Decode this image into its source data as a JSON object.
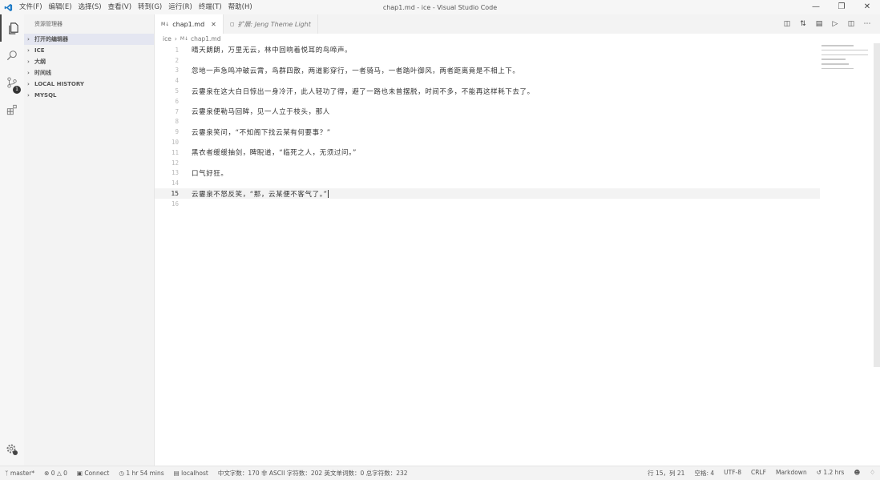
{
  "window": {
    "title": "chap1.md - ice - Visual Studio Code",
    "menu": [
      "文件(F)",
      "编辑(E)",
      "选择(S)",
      "查看(V)",
      "转到(G)",
      "运行(R)",
      "终端(T)",
      "帮助(H)"
    ]
  },
  "activity": {
    "scm_badge": "1"
  },
  "sidebar": {
    "title": "资源管理器",
    "sections": [
      "打开的编辑器",
      "ICE",
      "大纲",
      "时间线",
      "LOCAL HISTORY",
      "MYSQL"
    ]
  },
  "tabs": [
    {
      "label": "chap1.md",
      "icon": "markdown-icon"
    },
    {
      "label": "扩展: Jeng Theme Light",
      "icon": "extension-icon"
    }
  ],
  "breadcrumb": {
    "folder": "ice",
    "file": "chap1.md"
  },
  "editor": {
    "lines": [
      {
        "num": "1",
        "text": "晴天朗朗，万里无云，林中回响着悦耳的鸟啼声。"
      },
      {
        "num": "2",
        "text": ""
      },
      {
        "num": "3",
        "text": "忽地一声急鸣冲破云霄，鸟群四散，两道影穿行，一者骑马，一者踏叶御风，两者距离竟是不相上下。"
      },
      {
        "num": "4",
        "text": ""
      },
      {
        "num": "5",
        "text": "云霎泉在这大白日惊出一身冷汗，此人轻功了得，避了一路也未曾摆脱，时间不多，不能再这样耗下去了。"
      },
      {
        "num": "6",
        "text": ""
      },
      {
        "num": "7",
        "text": "云霎泉便勒马回眸，见一人立于枝头，那人"
      },
      {
        "num": "8",
        "text": ""
      },
      {
        "num": "9",
        "text": "云霎泉笑问，“不知阁下找云某有何要事？”"
      },
      {
        "num": "10",
        "text": ""
      },
      {
        "num": "11",
        "text": "黑衣者缓缓抽剑，睥睨道，“临死之人，无须过问。”"
      },
      {
        "num": "12",
        "text": ""
      },
      {
        "num": "13",
        "text": "口气好狂。"
      },
      {
        "num": "14",
        "text": ""
      },
      {
        "num": "15",
        "text": "云霎泉不怒反笑，“那，云某便不客气了。”"
      },
      {
        "num": "16",
        "text": ""
      }
    ],
    "current_line": "15"
  },
  "status": {
    "branch": "master*",
    "errors": "0",
    "warnings": "0",
    "connect": "Connect",
    "time": "1 hr 54 mins",
    "host": "localhost",
    "stats": "中文字数：170 非 ASCII 字符数：202 英文单词数：0 总字符数：232",
    "position": "行 15，列 21",
    "spaces": "空格: 4",
    "encoding": "UTF-8",
    "eol": "CRLF",
    "language": "Markdown",
    "hours": "1.2 hrs"
  }
}
